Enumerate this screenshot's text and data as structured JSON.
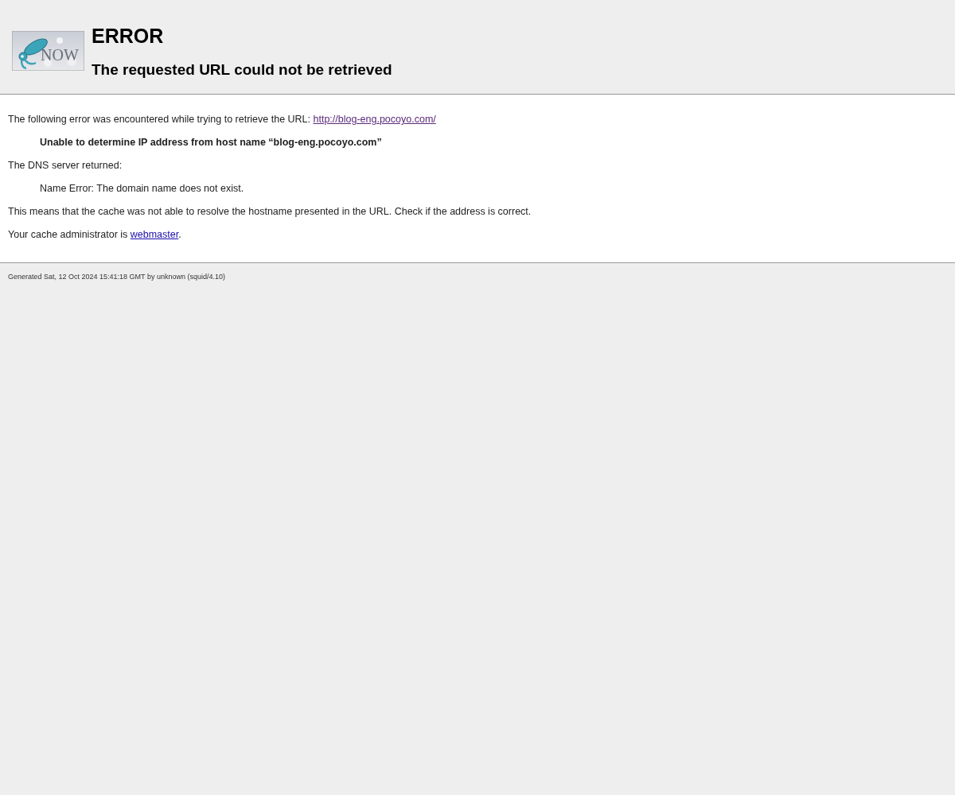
{
  "header": {
    "logo_text": "NOW",
    "title": "ERROR",
    "subtitle": "The requested URL could not be retrieved"
  },
  "paragraphs": [
    {
      "kind": "plain",
      "text": "The following error was encountered while trying to retrieve the URL: ",
      "link": "http://blog-eng.pocoyo.com/",
      "link_visited": true
    },
    {
      "kind": "indented_bold",
      "text": "Unable to determine IP address from host name “blog-eng.pocoyo.com”"
    },
    {
      "kind": "plain",
      "text": "The DNS server returned:"
    },
    {
      "kind": "indented",
      "text": "Name Error: The domain name does not exist."
    },
    {
      "kind": "plain",
      "text": "This means that the cache was not able to resolve the hostname presented in the URL. Check if the address is correct."
    },
    {
      "kind": "plain",
      "text": "Your cache administrator is ",
      "link": "webmaster",
      "link_visited": false,
      "after": "."
    }
  ],
  "footer": "Generated Sat, 12 Oct 2024 15:41:18 GMT by unknown (squid/4.10)"
}
